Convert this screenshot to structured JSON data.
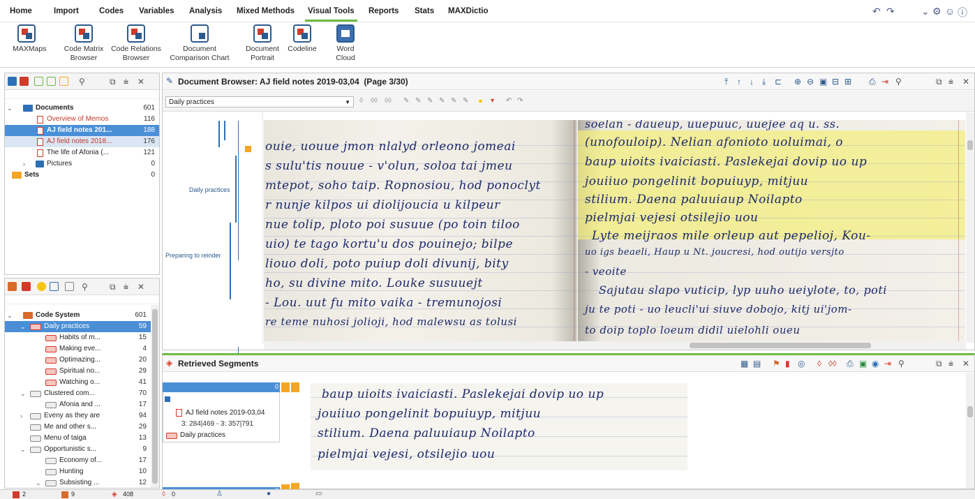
{
  "menu": {
    "tabs": [
      "Home",
      "Import",
      "Codes",
      "Variables",
      "Analysis",
      "Mixed Methods",
      "Visual Tools",
      "Reports",
      "Stats",
      "MAXDictio"
    ],
    "active": "Visual Tools"
  },
  "ribbon": {
    "buttons": [
      {
        "line1": "MAXMaps",
        "line2": ""
      },
      {
        "line1": "Code Matrix",
        "line2": "Browser"
      },
      {
        "line1": "Code Relations",
        "line2": "Browser"
      },
      {
        "line1": "Document",
        "line2": "Comparison Chart"
      },
      {
        "line1": "Document",
        "line2": "Portrait"
      },
      {
        "line1": "Codeline",
        "line2": ""
      },
      {
        "line1": "Word",
        "line2": "Cloud"
      }
    ]
  },
  "document_system": {
    "rows": [
      {
        "label": "Documents",
        "count": "601"
      },
      {
        "label": "Overview of Memos",
        "count": "116"
      },
      {
        "label": "AJ field notes 201...",
        "count": "188"
      },
      {
        "label": "AJ field notes 2018...",
        "count": "176"
      },
      {
        "label": "The life of Afonia (...",
        "count": "121"
      },
      {
        "label": "Pictures",
        "count": "0"
      },
      {
        "label": "Sets",
        "count": "0"
      }
    ]
  },
  "code_system": {
    "rows": [
      {
        "label": "Code System",
        "count": "601"
      },
      {
        "label": "Daily practices",
        "count": "59"
      },
      {
        "label": "Habits of m...",
        "count": "15"
      },
      {
        "label": "Making eve...",
        "count": "4"
      },
      {
        "label": "Optimazing...",
        "count": "20"
      },
      {
        "label": "Spiritual no...",
        "count": "29"
      },
      {
        "label": "Watching o...",
        "count": "41"
      },
      {
        "label": "Clustered com...",
        "count": "70"
      },
      {
        "label": "Afonia and ...",
        "count": "17"
      },
      {
        "label": "Eveny as they are",
        "count": "94"
      },
      {
        "label": "Me and other s...",
        "count": "29"
      },
      {
        "label": "Menu of taiga",
        "count": "13"
      },
      {
        "label": "Opportunistic s...",
        "count": "9"
      },
      {
        "label": "Economy of...",
        "count": "17"
      },
      {
        "label": "Hunting",
        "count": "10"
      },
      {
        "label": "Subsisting ...",
        "count": "12"
      }
    ]
  },
  "document_browser": {
    "title": "Document Browser: AJ field notes 2019-03,04",
    "page": "(Page 3/30)",
    "dropdown": "Daily practices",
    "code_labels": [
      "Daily practices",
      "Preparing to reinder"
    ],
    "left_page_lines": [
      "ouie, uouue jmon nlalyd orleono jomeai",
      "s sulu'tis nouue - v'olun, soloa tai jmeu",
      "mtepot, soho taip. Ropnosiou, hod ponoclyt",
      "r nunje kilpos ui diolijoucia u kilpeur",
      "nue tolip, ploto poi susuue (po toin tiloo",
      "uio) te tago kortu'u dos pouinejo; bilpe",
      "liouo doli, poto puiup doli divunij, bity",
      "ho, su divine mito. Louke susuuejt",
      "- Lou. uut fu mito vaika - tremunojosi",
      "re teme nuhosi jolioji, hod malewsu as tolusi"
    ],
    "right_page_lines": [
      "soelan - daueup, uuepuuc, uuejee aq u. ss.",
      "(unofouloip). Nelian afonioto uoluimai, o",
      "baup uioits ivaiciasti. Paslekejai dovip uo up",
      "jouiiuo pongelinit bopuiuyp, mitjuu",
      "stilium. Daena paluuiaup Noilapto",
      "pielmjai vejesi otsilejio uou",
      "Lyte meijraos mile orleup aut pepelioj, Kou-",
      "uo igs beaeli, Haup u Nt. joucresi, hod outijo versjto",
      "- veoite",
      "Sajutau slapo vuticip, lyp uuho ueiylote, to, poti",
      "ju te poti - uo leucli'ui siuve dobojo, kitj ui'jom-",
      "to doip toplo loeum didil uielohli oueu"
    ]
  },
  "retrieved_segments": {
    "title": "Retrieved Segments",
    "document": "AJ field notes 2019-03,04",
    "position": "3: 284|469 - 3: 357|791",
    "code": "Daily practices",
    "lines": [
      "baup uioits ivaiciasti. Paslekejai dovip uo up",
      "jouiiuo pongelinit bopuiuyp, mitjuu",
      "stilium. Daena paluuiaup Noilapto",
      "pielmjai vejesi, otsilejio uou"
    ]
  },
  "statusbar": {
    "items": [
      "2",
      "9",
      "408",
      "0",
      "",
      "",
      ""
    ]
  },
  "colors": {
    "accent_green": "#6fba44",
    "selection_blue": "#4a8fd6",
    "highlight_yellow": "#f4ee78",
    "ink": "#1d2a6b",
    "code_bar_orange": "#f5a623",
    "code_bar_blue": "#2d6fb6"
  }
}
